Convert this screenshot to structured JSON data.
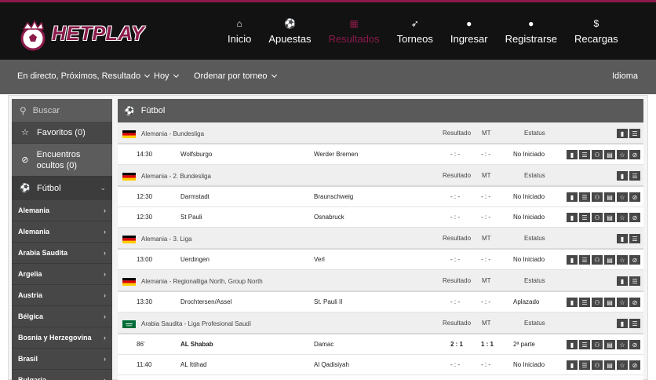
{
  "brand": {
    "logo_text": "HETPLAY",
    "accent": "#8b1a4a"
  },
  "nav": [
    {
      "label": "Inicio",
      "icon": "home-icon",
      "glyph": "⌂"
    },
    {
      "label": "Apuestas",
      "icon": "soccer-ball-icon",
      "glyph": "⚽"
    },
    {
      "label": "Resultados",
      "icon": "calendar-icon",
      "glyph": "▦",
      "active": true
    },
    {
      "label": "Torneos",
      "icon": "rocket-icon",
      "glyph": "➶"
    },
    {
      "label": "Ingresar",
      "icon": "user-icon",
      "glyph": "●"
    },
    {
      "label": "Registrarse",
      "icon": "user-icon",
      "glyph": "●"
    },
    {
      "label": "Recargas",
      "icon": "dollar-icon",
      "glyph": "$"
    }
  ],
  "subbar": {
    "filter1": "En directo, Próximos, Resultado",
    "filter2": "Hoy",
    "filter3": "Ordenar por torneo",
    "language": "Idioma"
  },
  "sidebar": {
    "search_placeholder": "Buscar",
    "favorites": "Favoritos (0)",
    "hidden": "Encuentros ocultos (0)",
    "sport": "Fútbol",
    "countries": [
      "Alemania",
      "Alemania",
      "Arabia Saudita",
      "Argelia",
      "Austria",
      "Bélgica",
      "Bosnia y Herzegovina",
      "Brasil",
      "Bulgaria"
    ]
  },
  "content": {
    "sport_title": "Fútbol",
    "col_result": "Resultado",
    "col_mt": "MT",
    "col_status": "Estatus",
    "leagues": [
      {
        "name": "Alemania - Bundesliga",
        "flag": "de",
        "matches": [
          {
            "time": "14:30",
            "home": "Wolfsburgo",
            "away": "Werder Bremen",
            "result": "- : -",
            "mt": "- : -",
            "status": "No Iniciado"
          }
        ]
      },
      {
        "name": "Alemania - 2. Bundesliga",
        "flag": "de",
        "matches": [
          {
            "time": "12:30",
            "home": "Darmstadt",
            "away": "Braunschweig",
            "result": "- : -",
            "mt": "- : -",
            "status": "No Iniciado"
          },
          {
            "time": "12:30",
            "home": "St Pauli",
            "away": "Osnabruck",
            "result": "- : -",
            "mt": "- : -",
            "status": "No Iniciado"
          }
        ]
      },
      {
        "name": "Alemania - 3. Liga",
        "flag": "de",
        "matches": [
          {
            "time": "13:00",
            "home": "Uerdingen",
            "away": "Verl",
            "result": "- : -",
            "mt": "- : -",
            "status": "No Iniciado"
          }
        ]
      },
      {
        "name": "Alemania - Regionalliga North, Group North",
        "flag": "de",
        "matches": [
          {
            "time": "13:30",
            "home": "Drochtersen/Assel",
            "away": "St. Pauli II",
            "result": "- : -",
            "mt": "- : -",
            "status": "Aplazado"
          }
        ]
      },
      {
        "name": "Arabia Saudita - Liga Profesional Saudí",
        "flag": "sa",
        "matches": [
          {
            "time": "86'",
            "home": "AL Shabab",
            "away": "Damac",
            "result": "2 : 1",
            "mt": "1 : 1",
            "status": "2ª parte",
            "live": true
          },
          {
            "time": "11:40",
            "home": "AL Ittihad",
            "away": "Al Qadisiyah",
            "result": "- : -",
            "mt": "- : -",
            "status": "No Iniciado"
          }
        ]
      }
    ]
  }
}
